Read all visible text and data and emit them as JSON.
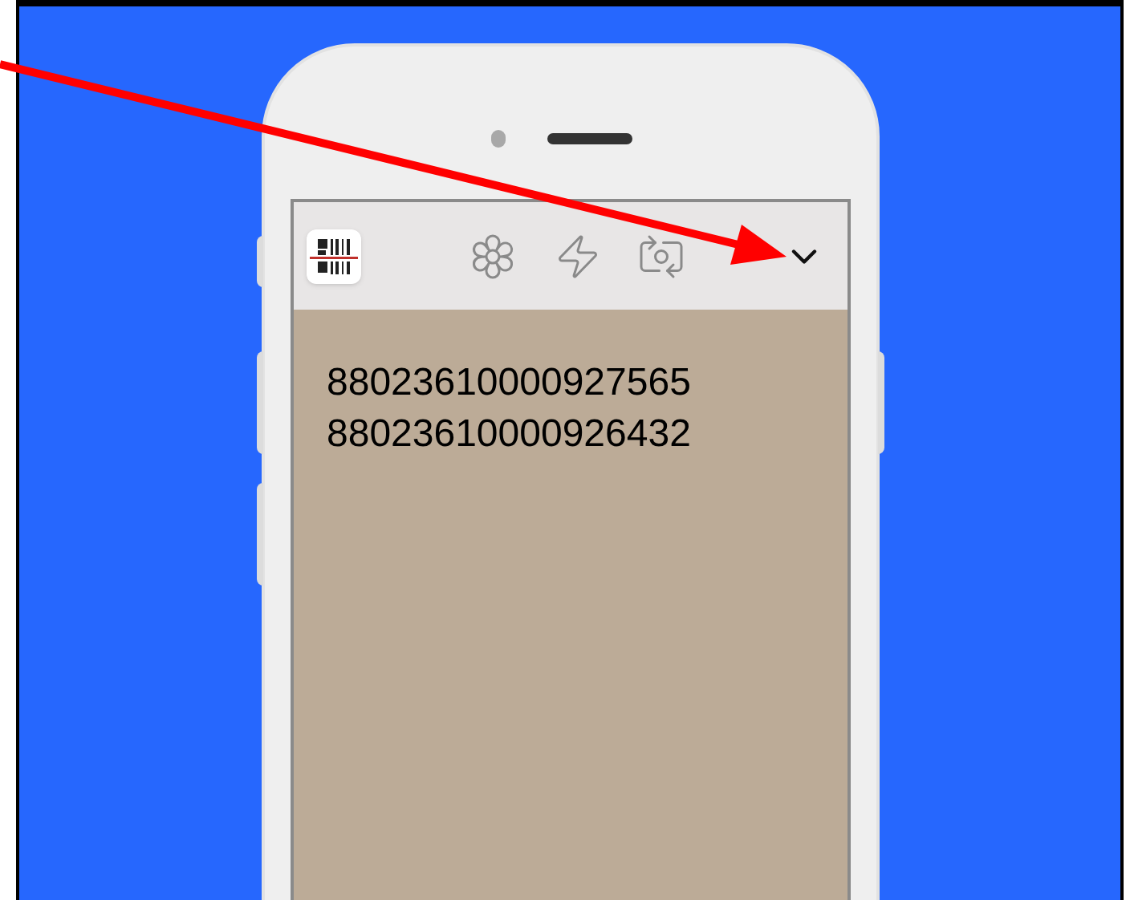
{
  "scanned_codes": [
    "88023610000927565",
    "88023610000926432"
  ]
}
